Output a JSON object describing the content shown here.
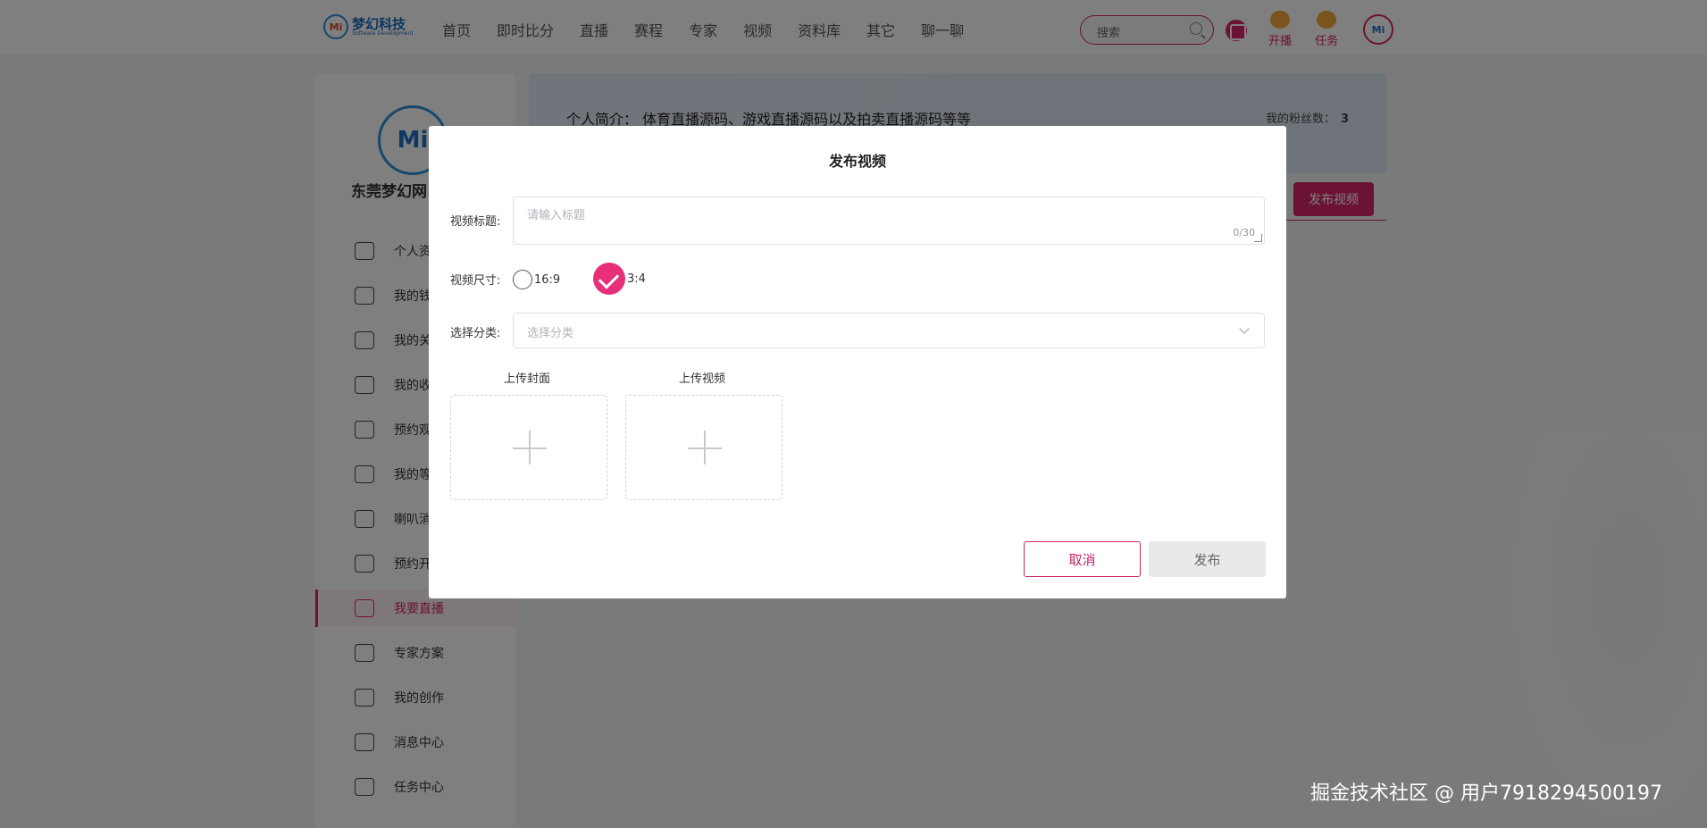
{
  "header": {
    "logo_cn": "梦幻科技",
    "logo_en": "Software Development",
    "logo_mark": "Mi",
    "nav": [
      "首页",
      "即时比分",
      "直播",
      "赛程",
      "专家",
      "视频",
      "资料库",
      "其它",
      "聊一聊"
    ],
    "search_placeholder": "搜索",
    "live_label": "开播",
    "task_label": "任务",
    "avatar_mark": "Mi"
  },
  "sidebar": {
    "avatar_mark": "Mi",
    "name": "东莞梦幻网",
    "items": [
      {
        "label": "个人资",
        "icon": "id-card-icon"
      },
      {
        "label": "我的钱",
        "icon": "wallet-icon"
      },
      {
        "label": "我的关",
        "icon": "heart-icon"
      },
      {
        "label": "我的收",
        "icon": "star-icon"
      },
      {
        "label": "预约观",
        "icon": "alarm-clock-icon"
      },
      {
        "label": "我的等",
        "icon": "diamond-icon"
      },
      {
        "label": "喇叭消",
        "icon": "megaphone-icon"
      },
      {
        "label": "预约开",
        "icon": "tv-icon"
      },
      {
        "label": "我要直播",
        "icon": "video-camera-icon",
        "active": true
      },
      {
        "label": "专家方案",
        "icon": "expert-icon"
      },
      {
        "label": "我的创作",
        "icon": "creation-icon"
      },
      {
        "label": "消息中心",
        "icon": "message-icon"
      },
      {
        "label": "任务中心",
        "icon": "task-icon"
      }
    ]
  },
  "profile": {
    "intro_label": "个人简介：",
    "intro_text": "体育直播源码、游戏直播源码以及拍卖直播源码等等",
    "fans_label": "我的粉丝数：",
    "fans_count": "3",
    "publish_button": "发布视频"
  },
  "modal": {
    "title": "发布视频",
    "title_label": "视频标题:",
    "title_placeholder": "请输入标题",
    "title_count": "0/30",
    "size_label": "视频尺寸:",
    "size_options": [
      {
        "label": "16:9",
        "selected": false
      },
      {
        "label": "3:4",
        "selected": true
      }
    ],
    "category_label": "选择分类:",
    "category_placeholder": "选择分类",
    "upload_cover_label": "上传封面",
    "upload_video_label": "上传视频",
    "cancel_label": "取消",
    "submit_label": "发布"
  },
  "watermark": "掘金技术社区 @ 用户7918294500197",
  "colors": {
    "accent": "#d6246a",
    "brand_blue": "#1d6fc2"
  }
}
